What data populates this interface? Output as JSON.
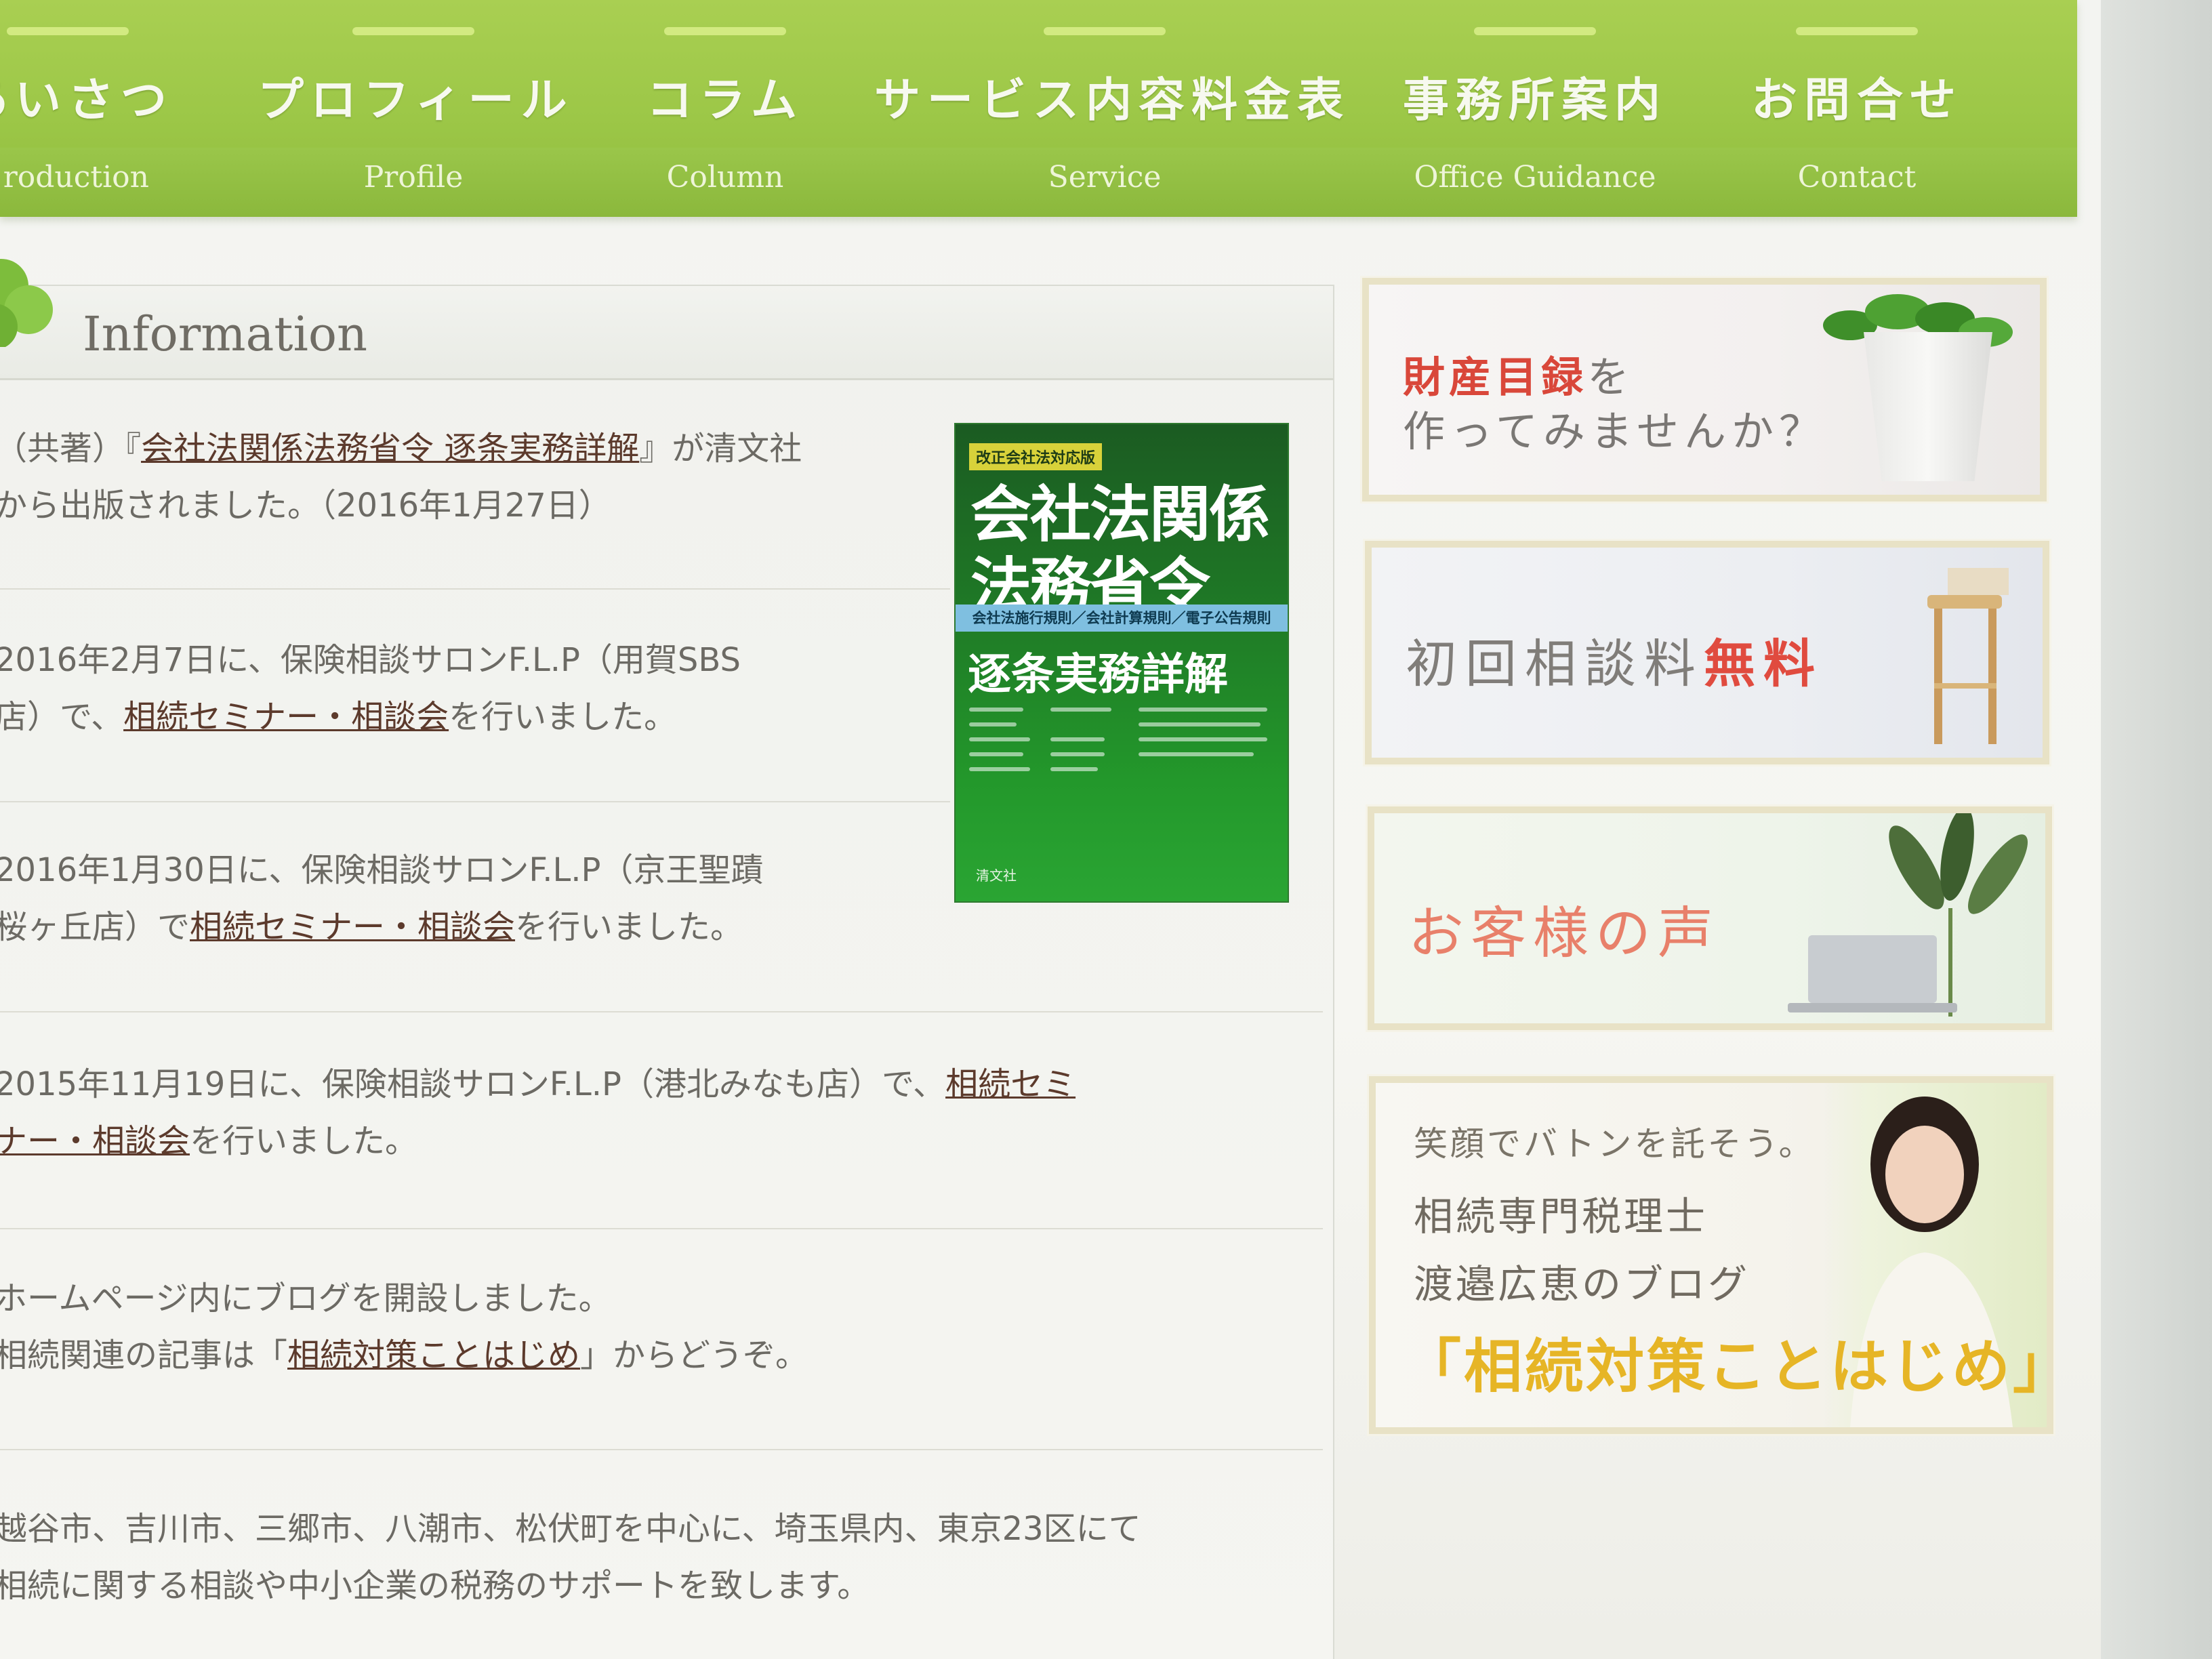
{
  "nav": {
    "items": [
      {
        "jp": "あいさつ",
        "en": "roduction"
      },
      {
        "jp": "プロフィール",
        "en": "Profile"
      },
      {
        "jp": "コラム",
        "en": "Column"
      },
      {
        "jp": "サービス内容料金表",
        "en": "Service"
      },
      {
        "jp": "事務所案内",
        "en": "Office Guidance"
      },
      {
        "jp": "お問合せ",
        "en": "Contact"
      }
    ]
  },
  "info": {
    "title": "Information",
    "news": [
      {
        "l1_pre": "（共著）『",
        "l1_link": "会社法関係法務省令 逐条実務詳解",
        "l1_post": "』が清文社",
        "l2": "から出版されました。（2016年1月27日）"
      },
      {
        "l1": "2016年2月7日に、保険相談サロンF.L.P（用賀SBS",
        "l2_pre": "店）で、",
        "l2_link": "相続セミナー・相談会",
        "l2_post": "を行いました。"
      },
      {
        "l1": "2016年1月30日に、保険相談サロンF.L.P（京王聖蹟",
        "l2_pre": "桜ヶ丘店）で",
        "l2_link": "相続セミナー・相談会",
        "l2_post": "を行いました。"
      },
      {
        "l1_pre": "2015年11月19日に、保険相談サロンF.L.P（港北みなも店）で、",
        "l1_link": "相続セミ",
        "l2_link": "ナー・相談会",
        "l2_post": "を行いました。"
      },
      {
        "l1": "ホームページ内にブログを開設しました。",
        "l2_pre": "相続関連の記事は「",
        "l2_link": "相続対策ことはじめ",
        "l2_post": "」からどうぞ。"
      },
      {
        "l1": "越谷市、吉川市、三郷市、八潮市、松伏町を中心に、埼玉県内、東京23区にて",
        "l2": "相続に関する相談や中小企業の税務のサポートを致します。"
      }
    ]
  },
  "book": {
    "series": "改正会社法対応版",
    "title1": "会社法関係",
    "title2": "法務省令",
    "band": "会社法施行規則／会社計算規則／電子公告規則",
    "subtitle": "逐条実務詳解",
    "publisher": "清文社"
  },
  "sidebar": {
    "assets": {
      "red": "財産目録",
      "gray": "を",
      "line2": "作ってみませんか？"
    },
    "free": {
      "gray": "初回相談料",
      "red": "無料"
    },
    "voice": {
      "label": "お客様の声"
    },
    "blog": {
      "l1": "笑顔でバトンを託そう。",
      "l2": "相続専門税理士",
      "l3": "渡邉広恵のブログ",
      "l4": "「相続対策ことはじめ」"
    }
  },
  "colors": {
    "nav_green": "#9cc747",
    "link_brown": "#5c3a2c",
    "accent_red": "#d9473a",
    "accent_yellow": "#e6b526"
  }
}
